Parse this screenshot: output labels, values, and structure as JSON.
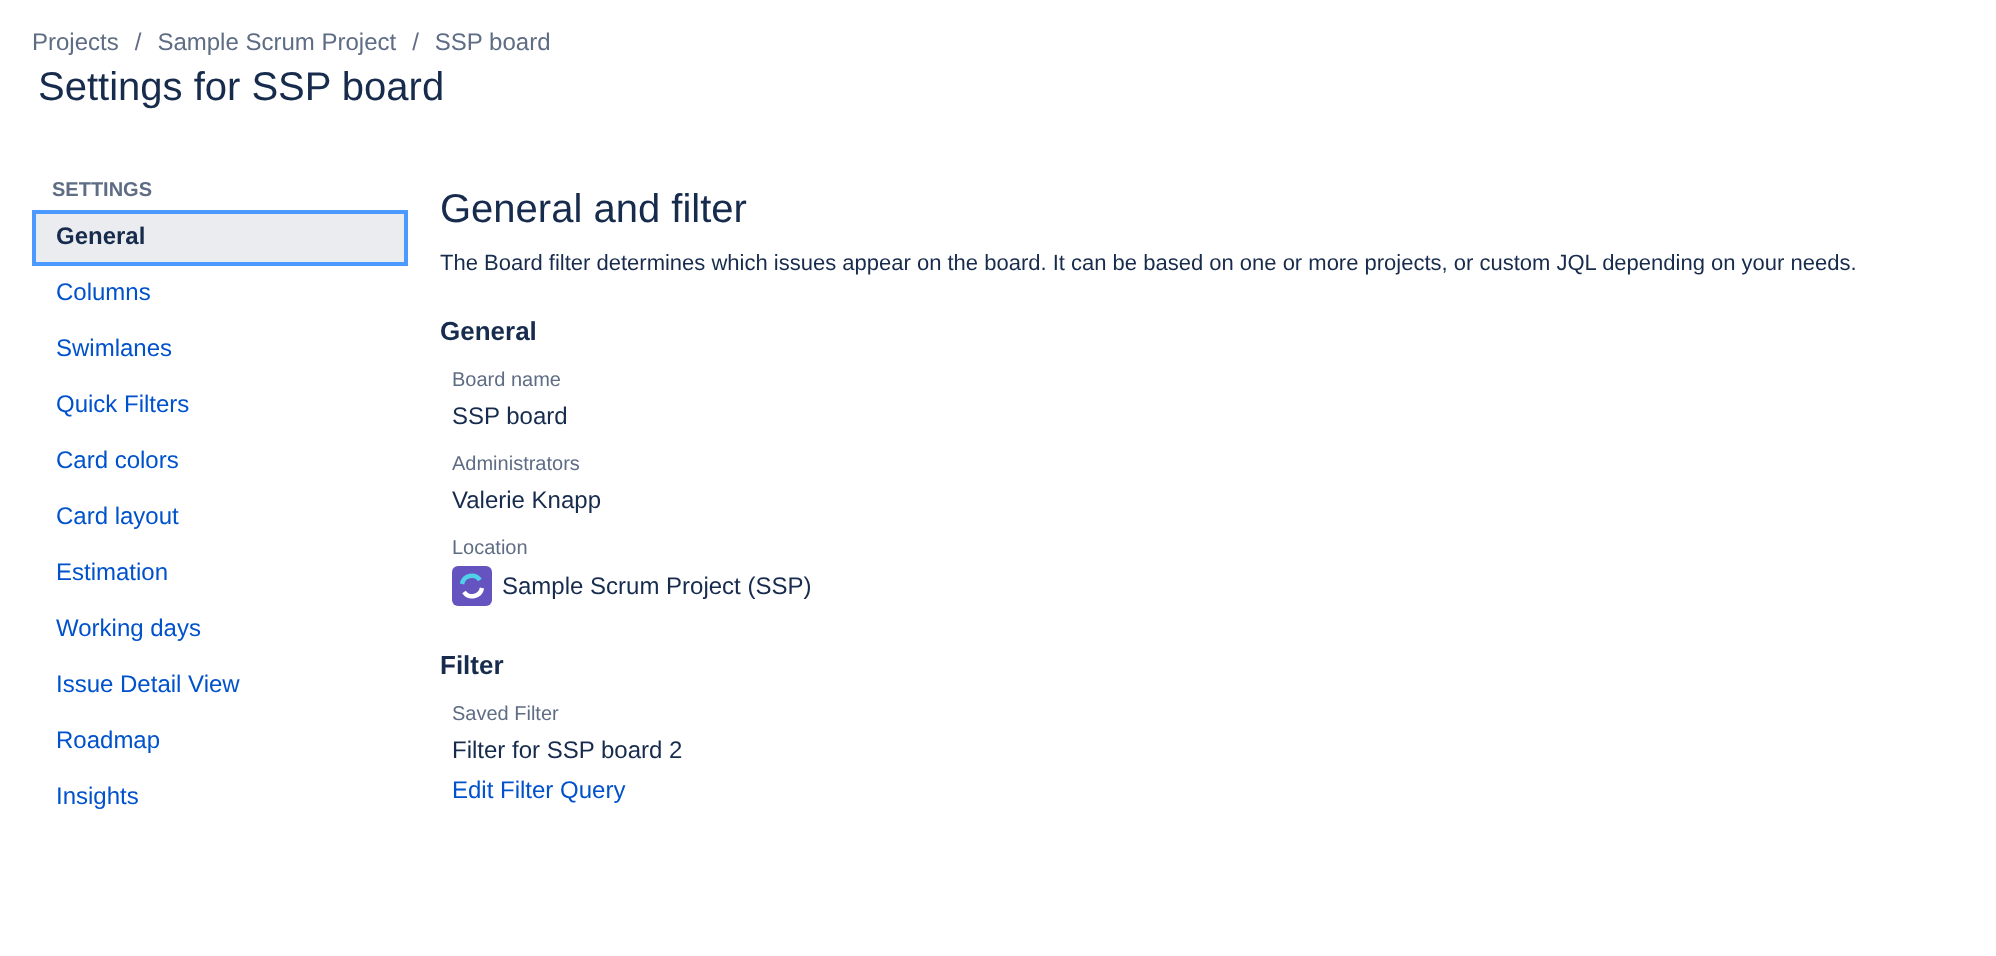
{
  "breadcrumbs": [
    "Projects",
    "Sample Scrum Project",
    "SSP board"
  ],
  "breadcrumb_separator": "/",
  "page_title": "Settings for SSP board",
  "sidebar": {
    "heading": "SETTINGS",
    "items": [
      {
        "label": "General",
        "selected": true
      },
      {
        "label": "Columns",
        "selected": false
      },
      {
        "label": "Swimlanes",
        "selected": false
      },
      {
        "label": "Quick Filters",
        "selected": false
      },
      {
        "label": "Card colors",
        "selected": false
      },
      {
        "label": "Card layout",
        "selected": false
      },
      {
        "label": "Estimation",
        "selected": false
      },
      {
        "label": "Working days",
        "selected": false
      },
      {
        "label": "Issue Detail View",
        "selected": false
      },
      {
        "label": "Roadmap",
        "selected": false
      },
      {
        "label": "Insights",
        "selected": false
      }
    ]
  },
  "main": {
    "title": "General and filter",
    "description": "The Board filter determines which issues appear on the board. It can be based on one or more projects, or custom JQL depending on your needs.",
    "sections": [
      {
        "heading": "General",
        "fields": [
          {
            "label": "Board name",
            "kind": "text",
            "value": "SSP board"
          },
          {
            "label": "Administrators",
            "kind": "text",
            "value": "Valerie Knapp"
          },
          {
            "label": "Location",
            "kind": "project",
            "value": "Sample Scrum Project (SSP)"
          }
        ]
      },
      {
        "heading": "Filter",
        "fields": [
          {
            "label": "Saved Filter",
            "kind": "text",
            "value": "Filter for SSP board 2",
            "link": "Edit Filter Query"
          }
        ]
      }
    ]
  }
}
